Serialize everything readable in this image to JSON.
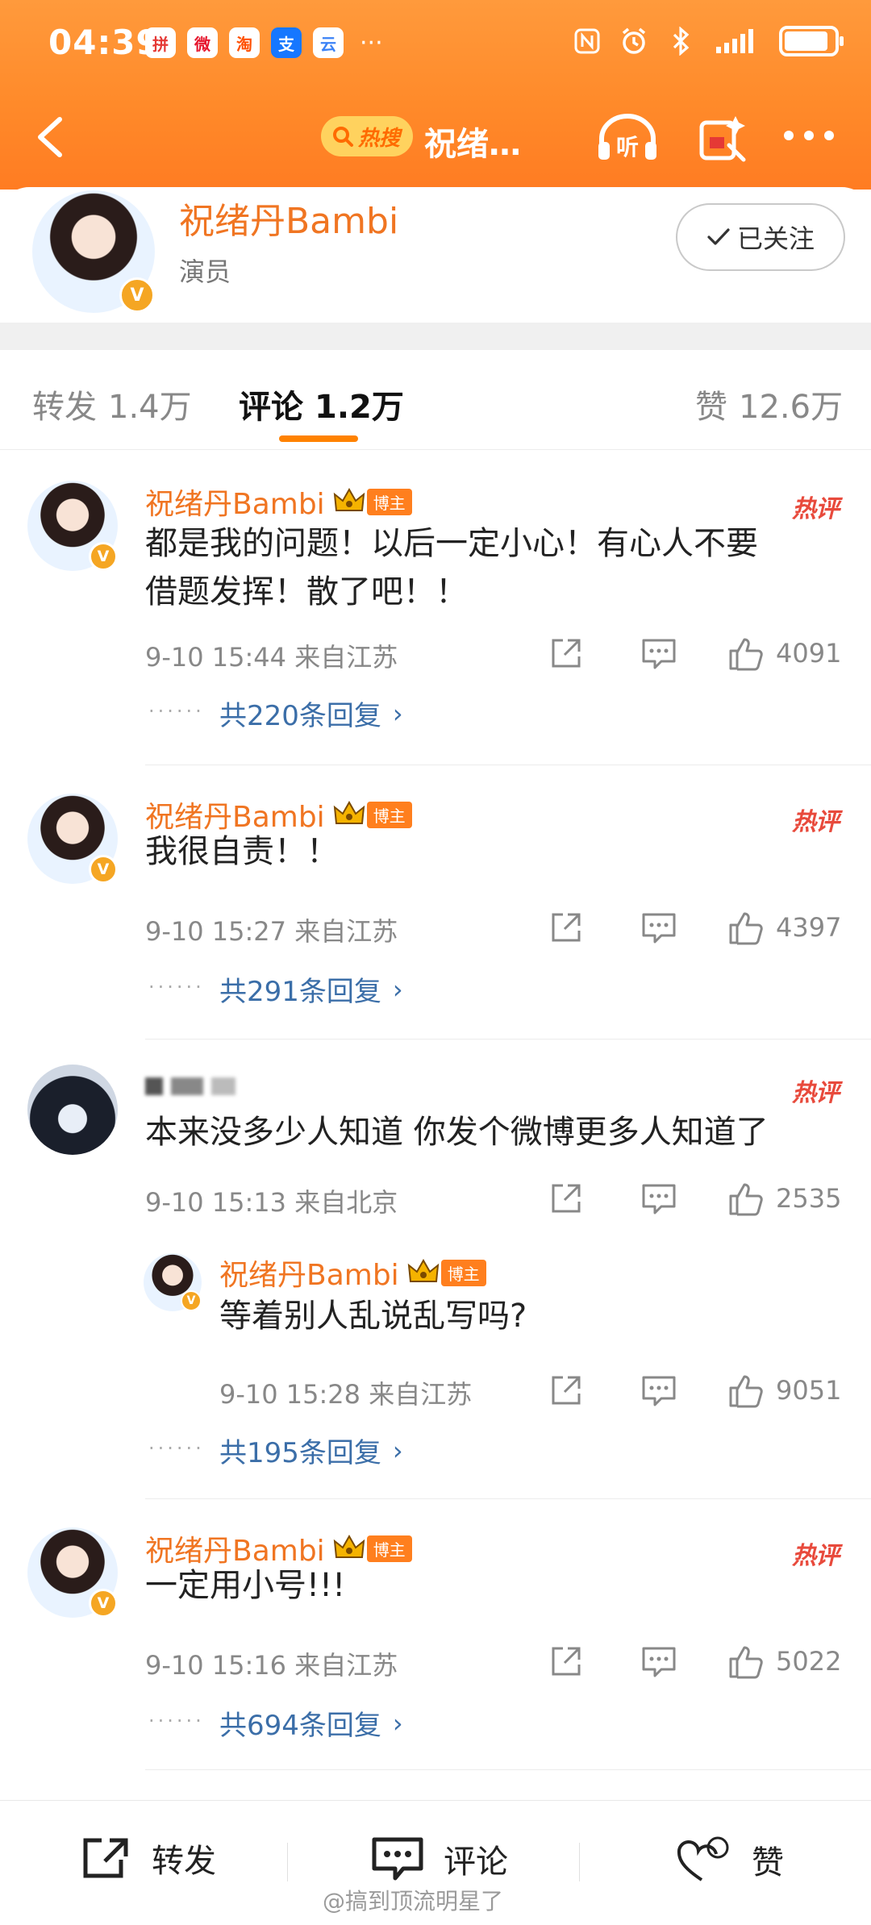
{
  "status_bar": {
    "time": "04:39",
    "app_icons": [
      "拼",
      "微",
      "淘",
      "支",
      "云"
    ],
    "more": "···"
  },
  "navbar": {
    "hot_search_label": "热搜",
    "title": "祝绪…",
    "listen_label": "听"
  },
  "author": {
    "name": "祝绪丹Bambi",
    "role": "演员",
    "follow_label": "已关注",
    "verified_badge": "V"
  },
  "tabs": {
    "repost_label": "转发",
    "repost_count": "1.4万",
    "comment_label": "评论",
    "comment_count": "1.2万",
    "like_label": "赞",
    "like_count": "12.6万"
  },
  "comments": [
    {
      "name": "祝绪丹Bambi",
      "blogger_tag": "博主",
      "hot_tag": "热评",
      "text_line1": "都是我的问题！以后一定小心！有心人不要",
      "text_line2": "借题发挥！散了吧！！",
      "meta": "9-10 15:44 来自江苏",
      "likes": "4091",
      "dots": "······",
      "more_replies": "共220条回复"
    },
    {
      "name": "祝绪丹Bambi",
      "blogger_tag": "博主",
      "hot_tag": "热评",
      "text_line1": "我很自责！！",
      "meta": "9-10 15:27 来自江苏",
      "likes": "4397",
      "dots": "······",
      "more_replies": "共291条回复"
    },
    {
      "hot_tag": "热评",
      "text_line1": "本来没多少人知道 你发个微博更多人知道了",
      "meta": "9-10 15:13 来自北京",
      "likes": "2535",
      "reply": {
        "name": "祝绪丹Bambi",
        "blogger_tag": "博主",
        "text": "等着别人乱说乱写吗?",
        "meta": "9-10 15:28 来自江苏",
        "likes": "9051"
      },
      "dots": "······",
      "more_replies": "共195条回复"
    },
    {
      "name": "祝绪丹Bambi",
      "blogger_tag": "博主",
      "hot_tag": "热评",
      "text_line1": "一定用小号!!!",
      "meta": "9-10 15:16 来自江苏",
      "likes": "5022",
      "dots": "······",
      "more_replies": "共694条回复"
    }
  ],
  "bottom_bar": {
    "repost_label": "转发",
    "comment_label": "评论",
    "like_label": "赞"
  },
  "watermark": "@搞到顶流明星了",
  "colors": {
    "header_orange": "#ff8a2a",
    "name_orange": "#f07522",
    "link_blue": "#3b6ea8",
    "hot_red": "#e84a3c",
    "tab_underline": "#ff8200"
  }
}
